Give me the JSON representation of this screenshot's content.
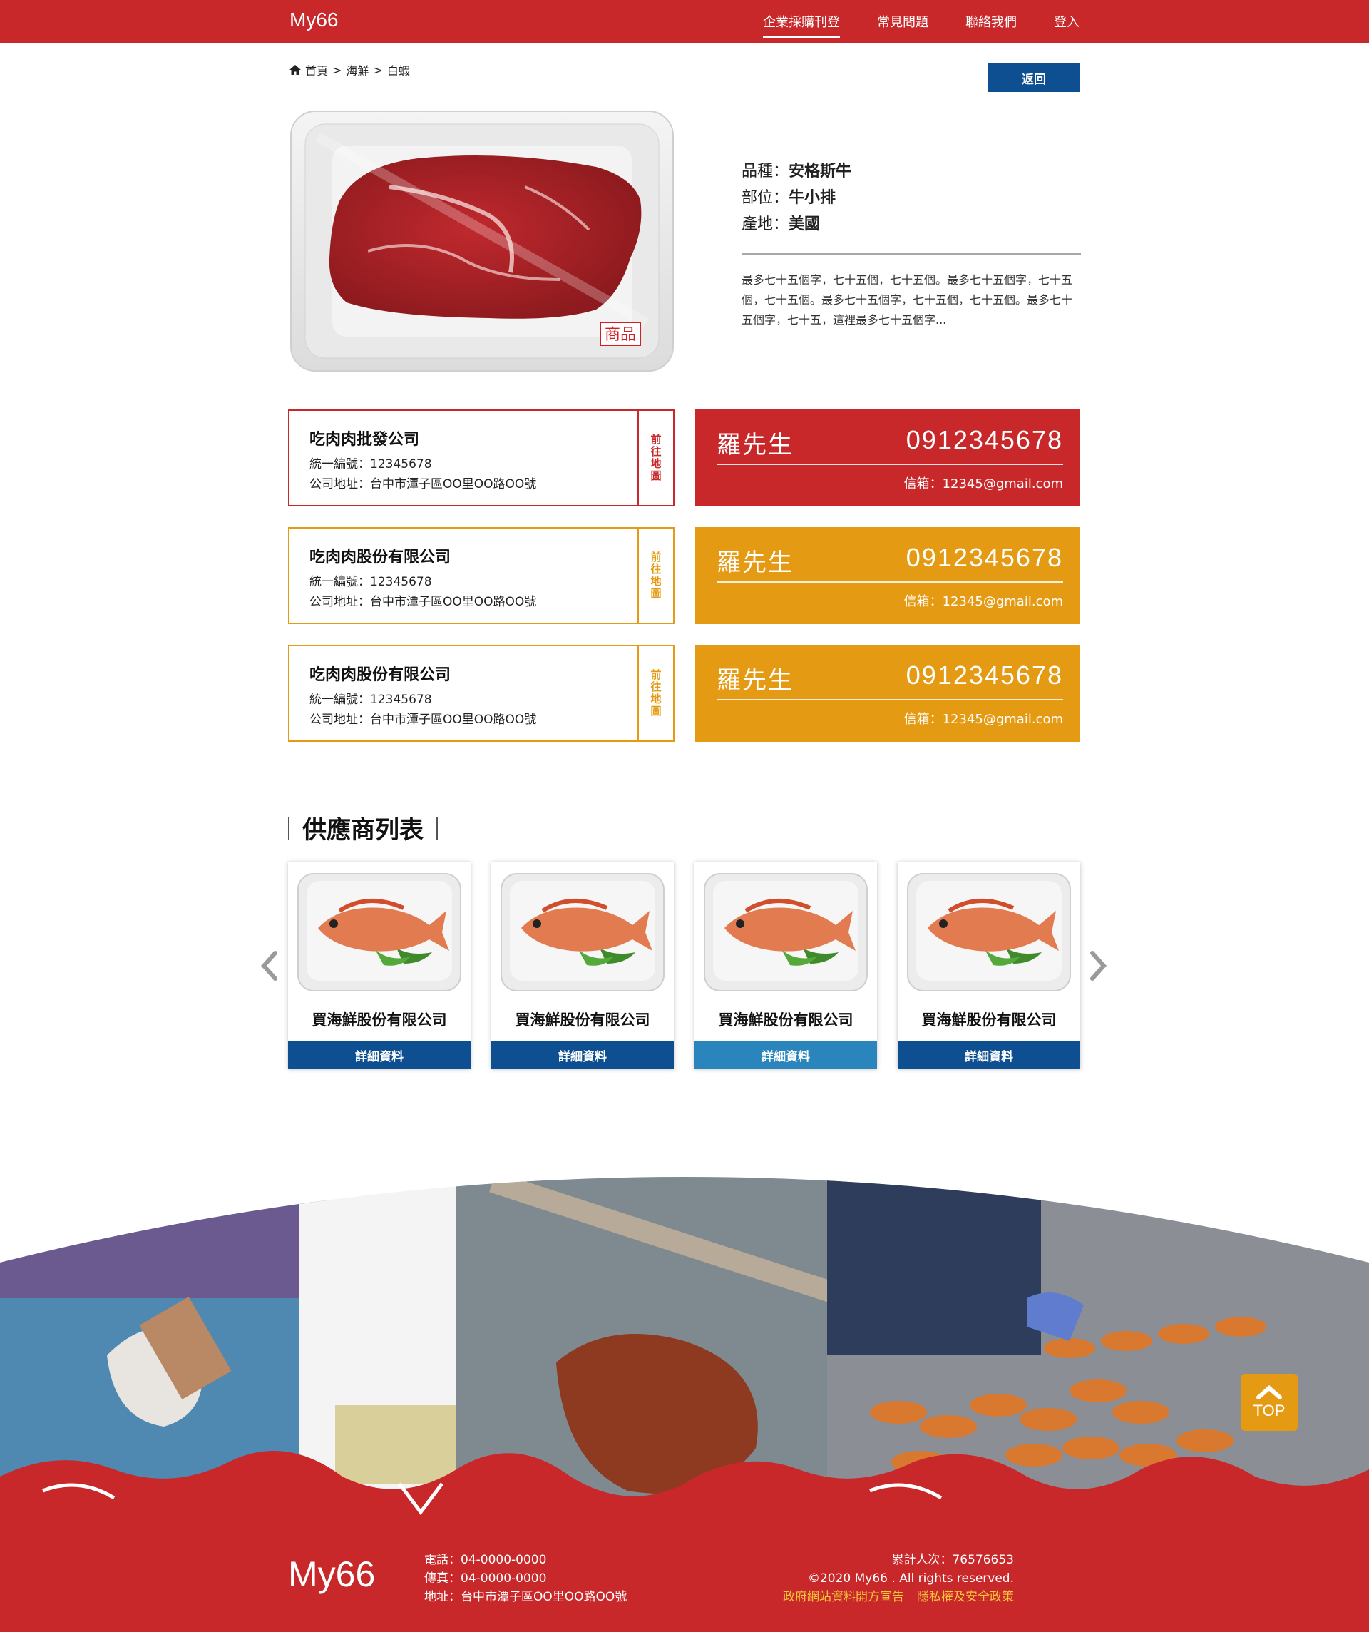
{
  "header": {
    "logo": "My66",
    "nav": [
      "企業採購刊登",
      "常見問題",
      "聯絡我們",
      "登入"
    ]
  },
  "breadcrumb": {
    "home": "首頁",
    "sep1": ">",
    "cat": "海鮮",
    "sep2": ">",
    "item": "白蝦"
  },
  "back_label": "返回",
  "product": {
    "badge": "商品",
    "variety_label": "品種：",
    "variety": "安格斯牛",
    "part_label": "部位：",
    "part": "牛小排",
    "origin_label": "產地：",
    "origin": "美國",
    "description": "最多七十五個字，七十五個，七十五個。最多七十五個字，七十五個，七十五個。最多七十五個字，七十五個，七十五個。最多七十五個字，七十五，這裡最多七十五個字..."
  },
  "suppliers": [
    {
      "name": "吃肉肉批發公司",
      "tax_id": "統一編號：12345678",
      "address": "公司地址：台中市潭子區OO里OO路OO號",
      "map_label": "前往地圖",
      "contact_name": "羅先生",
      "phone": "0912345678",
      "email": "信箱：12345@gmail.com",
      "color": "#c8282a"
    },
    {
      "name": "吃肉肉股份有限公司",
      "tax_id": "統一編號：12345678",
      "address": "公司地址：台中市潭子區OO里OO路OO號",
      "map_label": "前往地圖",
      "contact_name": "羅先生",
      "phone": "0912345678",
      "email": "信箱：12345@gmail.com",
      "color": "#e49a12"
    },
    {
      "name": "吃肉肉股份有限公司",
      "tax_id": "統一編號：12345678",
      "address": "公司地址：台中市潭子區OO里OO路OO號",
      "map_label": "前往地圖",
      "contact_name": "羅先生",
      "phone": "0912345678",
      "email": "信箱：12345@gmail.com",
      "color": "#e49a12"
    }
  ],
  "supplier_list": {
    "title": "供應商列表",
    "cards": [
      {
        "name": "買海鮮股份有限公司",
        "button": "詳細資料",
        "button_color": "#0d4f91"
      },
      {
        "name": "買海鮮股份有限公司",
        "button": "詳細資料",
        "button_color": "#0d4f91"
      },
      {
        "name": "買海鮮股份有限公司",
        "button": "詳細資料",
        "button_color": "#2a85bd"
      },
      {
        "name": "買海鮮股份有限公司",
        "button": "詳細資料",
        "button_color": "#0d4f91"
      }
    ]
  },
  "top_button": "TOP",
  "footer": {
    "logo": "My66",
    "phone": "電話：04-0000-0000",
    "fax": "傳真：04-0000-0000",
    "address": "地址：台中市潭子區OO里OO路OO號",
    "visits": "累計人次：76576653",
    "copyright": "©2020 My66 . All rights reserved.",
    "link1": "政府網站資料開方宣告",
    "link2": "隱私權及安全政策"
  },
  "colors": {
    "brand_red": "#c8282a",
    "accent_orange": "#e49a12",
    "button_blue": "#0d4f91"
  }
}
